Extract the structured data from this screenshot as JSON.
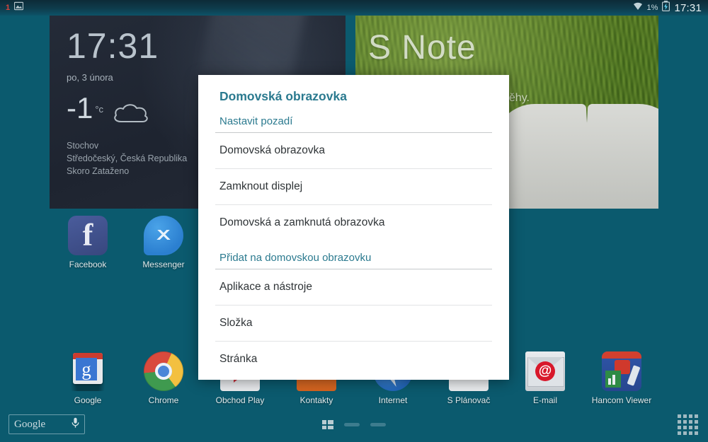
{
  "statusbar": {
    "notification_count": "1",
    "screenshot_icon": "image-icon",
    "wifi_icon": "wifi-icon",
    "battery_percent": "1%",
    "battery_icon": "battery-charging-icon",
    "clock": "17:31"
  },
  "clock_widget": {
    "time": "17:31",
    "date": "po, 3 února",
    "temperature": "-1",
    "unit": "°c",
    "weather_icon": "cloud-icon",
    "city": "Stochov",
    "region": "Středočeský, Česká Republika",
    "condition": "Skoro Zataženo"
  },
  "snote_widget": {
    "title": "S Note",
    "subtitle": "ými příběhy."
  },
  "apps": [
    {
      "label": "Facebook",
      "icon": "facebook-icon"
    },
    {
      "label": "Messenger",
      "icon": "messenger-icon"
    },
    {
      "label": "Google",
      "icon": "google-icon"
    },
    {
      "label": "Chrome",
      "icon": "chrome-icon"
    },
    {
      "label": "Obchod Play",
      "icon": "play-store-icon"
    },
    {
      "label": "Kontakty",
      "icon": "contacts-icon"
    },
    {
      "label": "Internet",
      "icon": "internet-icon"
    },
    {
      "label": "S Plánovač",
      "icon": "calendar-icon"
    },
    {
      "label": "E-mail",
      "icon": "email-icon"
    },
    {
      "label": "Hancom Viewer",
      "icon": "hancom-viewer-icon"
    }
  ],
  "bottom_bar": {
    "search_text": "Google",
    "mic_icon": "microphone-icon",
    "apps_button_icon": "apps-grid-icon",
    "page_indicator_active_index": 0,
    "page_count": 3
  },
  "dialog": {
    "title": "Domovská obrazovka",
    "sections": [
      {
        "header": "Nastavit pozadí",
        "items": [
          "Domovská obrazovka",
          "Zamknout displej",
          "Domovská a zamknutá obrazovka"
        ]
      },
      {
        "header": "Přidat na domovskou obrazovku",
        "items": [
          "Aplikace a nástroje",
          "Složka",
          "Stránka"
        ]
      }
    ]
  },
  "colors": {
    "wallpaper": "#0b5a6e",
    "dialog_accent": "#2b7a8f",
    "statusbar_badge": "#d6453c"
  }
}
